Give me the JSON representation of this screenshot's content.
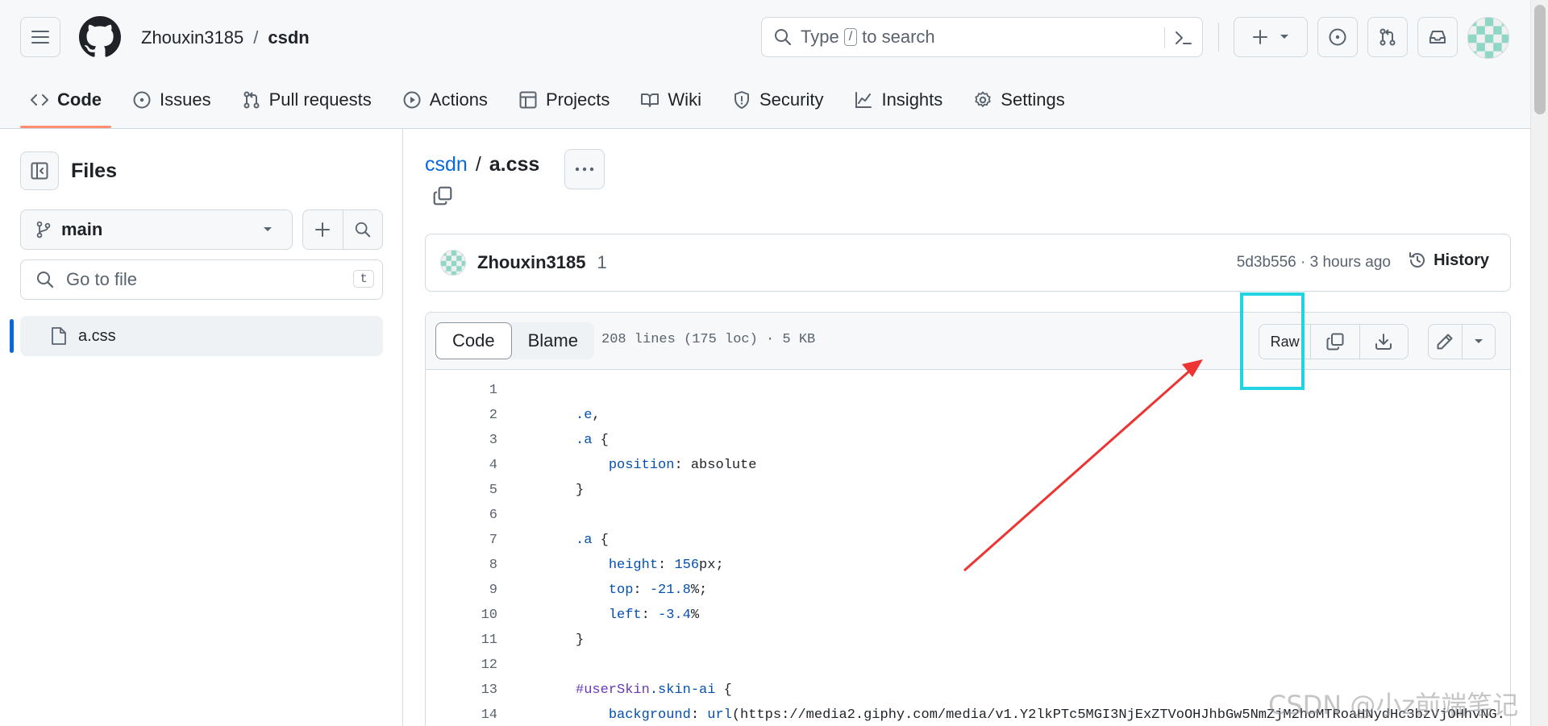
{
  "header": {
    "owner": "Zhouxin3185",
    "separator": "/",
    "repo": "csdn",
    "search": {
      "prefix": "Type",
      "kbd": "/",
      "suffix": "to search"
    }
  },
  "tabs": [
    {
      "label": "Code",
      "icon": "code-icon",
      "active": true
    },
    {
      "label": "Issues",
      "icon": "issue-icon"
    },
    {
      "label": "Pull requests",
      "icon": "pull-request-icon"
    },
    {
      "label": "Actions",
      "icon": "play-icon"
    },
    {
      "label": "Projects",
      "icon": "table-icon"
    },
    {
      "label": "Wiki",
      "icon": "book-icon"
    },
    {
      "label": "Security",
      "icon": "shield-icon"
    },
    {
      "label": "Insights",
      "icon": "graph-icon"
    },
    {
      "label": "Settings",
      "icon": "gear-icon"
    }
  ],
  "sidebar": {
    "title": "Files",
    "branch": "main",
    "goto_placeholder": "Go to file",
    "goto_kbd": "t",
    "files": [
      {
        "name": "a.css",
        "selected": true
      }
    ]
  },
  "main": {
    "repo_link": "csdn",
    "separator": "/",
    "file_name": "a.css",
    "commit": {
      "author": "Zhouxin3185",
      "message": "1",
      "meta": "5d3b556 · 3 hours ago",
      "history_label": "History"
    },
    "file": {
      "tab_code": "Code",
      "tab_blame": "Blame",
      "stats": "208 lines (175 loc) · 5 KB",
      "raw_label": "Raw"
    },
    "code_lines": [
      {
        "n": "1",
        "text": ""
      },
      {
        "n": "2",
        "text": ".e,"
      },
      {
        "n": "3",
        "text": ".a {"
      },
      {
        "n": "4",
        "text": "    position: absolute"
      },
      {
        "n": "5",
        "text": "}"
      },
      {
        "n": "6",
        "text": ""
      },
      {
        "n": "7",
        "text": ".a {"
      },
      {
        "n": "8",
        "text": "    height: 156px;"
      },
      {
        "n": "9",
        "text": "    top: -21.8%;"
      },
      {
        "n": "10",
        "text": "    left: -3.4%"
      },
      {
        "n": "11",
        "text": "}"
      },
      {
        "n": "12",
        "text": ""
      },
      {
        "n": "13",
        "text": "#userSkin.skin-ai {"
      },
      {
        "n": "14",
        "text": "    background: url(https://media2.giphy.com/media/v1.Y2lkPTc5MGI3NjExZTVoOHJhbGw5NmZjM2hoMTRoaHNydHc3bzVjOHhvNG."
      }
    ]
  },
  "watermark": "CSDN @小z前端笔记",
  "colors": {
    "accent": "#fd8c73",
    "link": "#0969da",
    "highlight": "#21d4e0",
    "arrow": "#ee3333"
  }
}
